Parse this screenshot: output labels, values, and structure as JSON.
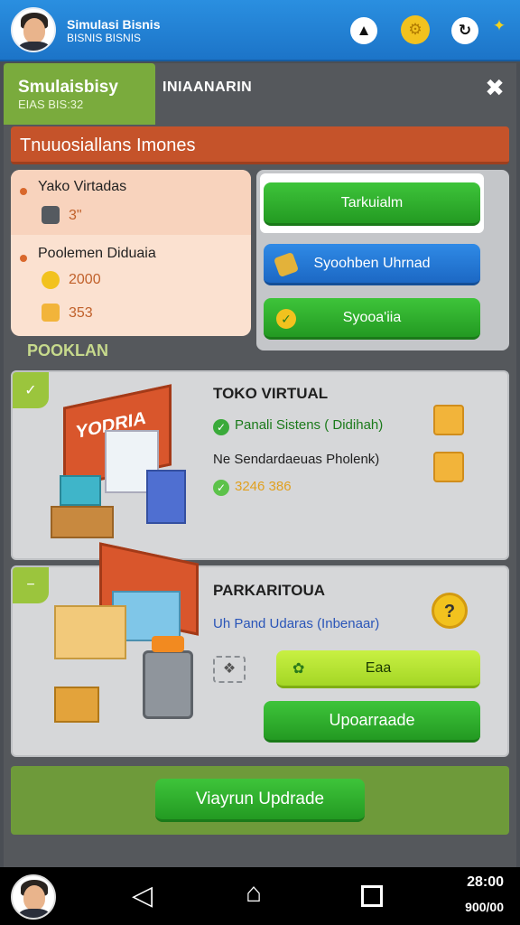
{
  "header": {
    "title": "Simulasi Bisnis",
    "subtitle": "BISNIS BISNIS",
    "icons": [
      "alert-icon",
      "gear-icon",
      "refresh-icon",
      "wrench-icon"
    ]
  },
  "tabs": {
    "active_title": "Smulaisbisy",
    "active_sub": "EIAS BIS:32",
    "inactive_label": "INIAANARIN"
  },
  "banner": {
    "text": "Tnuuosiallans Imones"
  },
  "stats": {
    "item1_label": "Yako Virtadas",
    "item1_value": "3\"",
    "item2_label": "Poolemen Diduaia",
    "item2_value_a": "2000",
    "item2_value_b": "353"
  },
  "actions": {
    "btn1": "Tarkuialm",
    "btn2": "Syoohben Uhrnad",
    "btn3": "Syooa'iia"
  },
  "section_label": "POOKLAN",
  "shop1": {
    "sign": "YODRIA",
    "title": "TOKO VIRTUAL",
    "line1": "Panali Sistens ( Didihah)",
    "line2": "Ne Sendardaeuas Pholenk)",
    "line3": "3246 386"
  },
  "shop2": {
    "title": "PARKARITOUA",
    "line1": "Uh Pand Udaras (Inbenaar)",
    "btn_upgrade_small": "Eaa",
    "btn_upgrade": "Upoarraade"
  },
  "footer": {
    "button": "Viayrun Updrade"
  },
  "nav": {
    "time": "28:00",
    "sub": "900/00"
  },
  "colors": {
    "accent_green": "#2fb02b",
    "accent_blue": "#1c74c8",
    "accent_orange": "#c5532a"
  }
}
